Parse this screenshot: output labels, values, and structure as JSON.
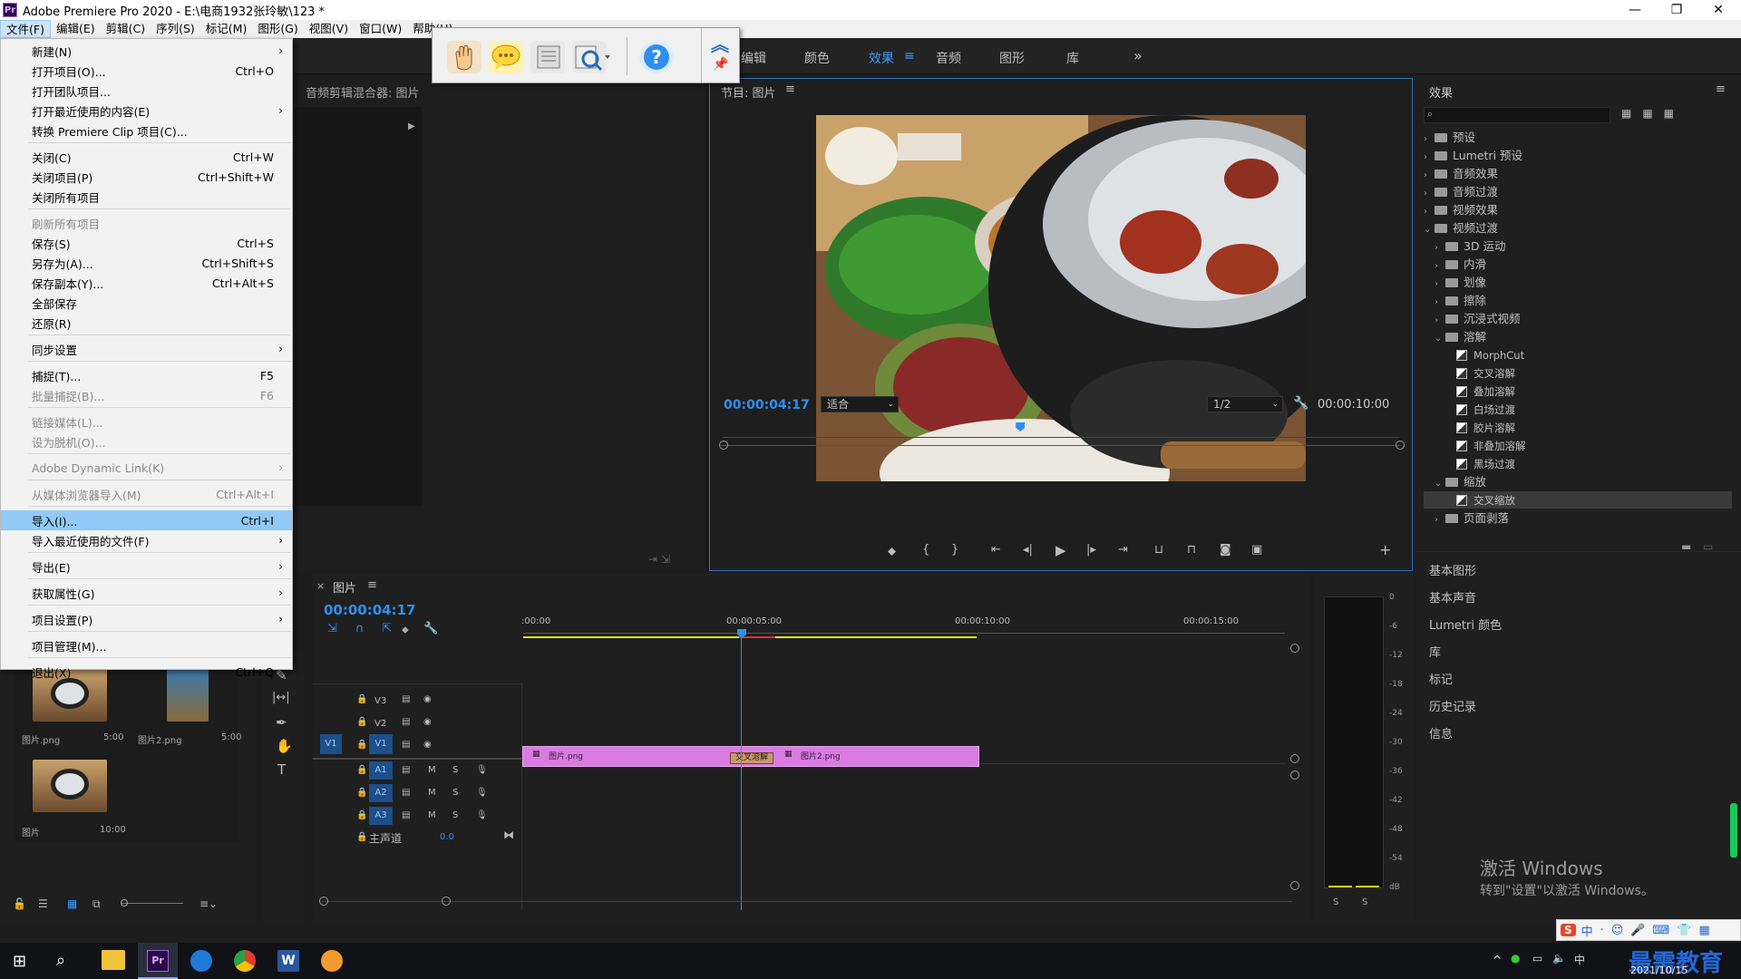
{
  "app": {
    "title": "Adobe Premiere Pro 2020 - E:\\电商1932张玲敏\\123 *",
    "logo": "Pr"
  },
  "window_controls": {
    "minimize": "—",
    "maximize": "❐",
    "close": "✕"
  },
  "menubar": [
    "文件(F)",
    "编辑(E)",
    "剪辑(C)",
    "序列(S)",
    "标记(M)",
    "图形(G)",
    "视图(V)",
    "窗口(W)",
    "帮助(H)"
  ],
  "workspace_tabs": [
    "编辑",
    "颜色",
    "效果",
    "音频",
    "图形",
    "库"
  ],
  "workspace_active": "效果",
  "workspace_more": "»",
  "file_menu": [
    {
      "label": "新建(N)",
      "shortcut": "",
      "arrow": true,
      "disabled": false
    },
    {
      "label": "打开项目(O)...",
      "shortcut": "Ctrl+O",
      "arrow": false,
      "disabled": false
    },
    {
      "label": "打开团队项目...",
      "shortcut": "",
      "arrow": false,
      "disabled": false
    },
    {
      "label": "打开最近使用的内容(E)",
      "shortcut": "",
      "arrow": true,
      "disabled": false
    },
    {
      "label": "转换 Premiere Clip 项目(C)...",
      "shortcut": "",
      "arrow": false,
      "disabled": false
    },
    {
      "label": "关闭(C)",
      "shortcut": "Ctrl+W",
      "arrow": false,
      "disabled": false
    },
    {
      "label": "关闭项目(P)",
      "shortcut": "Ctrl+Shift+W",
      "arrow": false,
      "disabled": false
    },
    {
      "label": "关闭所有项目",
      "shortcut": "",
      "arrow": false,
      "disabled": false
    },
    {
      "label": "刷新所有项目",
      "shortcut": "",
      "arrow": false,
      "disabled": true
    },
    {
      "label": "保存(S)",
      "shortcut": "Ctrl+S",
      "arrow": false,
      "disabled": false
    },
    {
      "label": "另存为(A)...",
      "shortcut": "Ctrl+Shift+S",
      "arrow": false,
      "disabled": false
    },
    {
      "label": "保存副本(Y)...",
      "shortcut": "Ctrl+Alt+S",
      "arrow": false,
      "disabled": false
    },
    {
      "label": "全部保存",
      "shortcut": "",
      "arrow": false,
      "disabled": false
    },
    {
      "label": "还原(R)",
      "shortcut": "",
      "arrow": false,
      "disabled": false
    },
    {
      "label": "同步设置",
      "shortcut": "",
      "arrow": true,
      "disabled": false
    },
    {
      "label": "捕捉(T)...",
      "shortcut": "F5",
      "arrow": false,
      "disabled": false
    },
    {
      "label": "批量捕捉(B)...",
      "shortcut": "F6",
      "arrow": false,
      "disabled": true
    },
    {
      "label": "链接媒体(L)...",
      "shortcut": "",
      "arrow": false,
      "disabled": true
    },
    {
      "label": "设为脱机(O)...",
      "shortcut": "",
      "arrow": false,
      "disabled": true
    },
    {
      "label": "Adobe Dynamic Link(K)",
      "shortcut": "",
      "arrow": true,
      "disabled": true
    },
    {
      "label": "从媒体浏览器导入(M)",
      "shortcut": "Ctrl+Alt+I",
      "arrow": false,
      "disabled": true
    },
    {
      "label": "导入(I)...",
      "shortcut": "Ctrl+I",
      "arrow": false,
      "disabled": false,
      "highlight": true
    },
    {
      "label": "导入最近使用的文件(F)",
      "shortcut": "",
      "arrow": true,
      "disabled": false
    },
    {
      "label": "导出(E)",
      "shortcut": "",
      "arrow": true,
      "disabled": false
    },
    {
      "label": "获取属性(G)",
      "shortcut": "",
      "arrow": true,
      "disabled": false
    },
    {
      "label": "项目设置(P)",
      "shortcut": "",
      "arrow": true,
      "disabled": false
    },
    {
      "label": "项目管理(M)...",
      "shortcut": "",
      "arrow": false,
      "disabled": false
    },
    {
      "label": "退出(X)",
      "shortcut": "Ctrl+Q",
      "arrow": false,
      "disabled": false
    }
  ],
  "source_panel": {
    "title": "音频剪辑混合器: 图片"
  },
  "program": {
    "title": "节目: 图片",
    "timecode": "00:00:04:17",
    "fit": "适合",
    "resolution": "1/2",
    "duration": "00:00:10:00",
    "playhead_fraction": 0.44
  },
  "effects": {
    "title": "效果",
    "tree": [
      {
        "label": "预设",
        "level": 0,
        "type": "folder",
        "open": false
      },
      {
        "label": "Lumetri 预设",
        "level": 0,
        "type": "folder",
        "open": false
      },
      {
        "label": "音频效果",
        "level": 0,
        "type": "folder",
        "open": false
      },
      {
        "label": "音频过渡",
        "level": 0,
        "type": "folder",
        "open": false
      },
      {
        "label": "视频效果",
        "level": 0,
        "type": "folder",
        "open": false
      },
      {
        "label": "视频过渡",
        "level": 0,
        "type": "folder",
        "open": true
      },
      {
        "label": "3D 运动",
        "level": 1,
        "type": "folder",
        "open": false
      },
      {
        "label": "内滑",
        "level": 1,
        "type": "folder",
        "open": false
      },
      {
        "label": "划像",
        "level": 1,
        "type": "folder",
        "open": false
      },
      {
        "label": "擦除",
        "level": 1,
        "type": "folder",
        "open": false
      },
      {
        "label": "沉浸式视频",
        "level": 1,
        "type": "folder",
        "open": false
      },
      {
        "label": "溶解",
        "level": 1,
        "type": "folder",
        "open": true
      },
      {
        "label": "MorphCut",
        "level": 2,
        "type": "fx"
      },
      {
        "label": "交叉溶解",
        "level": 2,
        "type": "fx"
      },
      {
        "label": "叠加溶解",
        "level": 2,
        "type": "fx"
      },
      {
        "label": "白场过渡",
        "level": 2,
        "type": "fx"
      },
      {
        "label": "胶片溶解",
        "level": 2,
        "type": "fx"
      },
      {
        "label": "非叠加溶解",
        "level": 2,
        "type": "fx"
      },
      {
        "label": "黑场过渡",
        "level": 2,
        "type": "fx"
      },
      {
        "label": "缩放",
        "level": 1,
        "type": "folder",
        "open": true
      },
      {
        "label": "交叉缩放",
        "level": 2,
        "type": "fx",
        "selected": true
      },
      {
        "label": "页面剥落",
        "level": 1,
        "type": "folder",
        "open": false
      }
    ],
    "sections": [
      "基本图形",
      "基本声音",
      "Lumetri 颜色",
      "库",
      "标记",
      "历史记录",
      "信息"
    ]
  },
  "timeline": {
    "tab": "图片",
    "timecode": "00:00:04:17",
    "ruler": [
      ":00:00",
      "00:00:05:00",
      "00:00:10:00",
      "00:00:15:00"
    ],
    "video_tracks": [
      "V3",
      "V2",
      "V1"
    ],
    "audio_tracks": [
      "A1",
      "A2",
      "A3"
    ],
    "master": {
      "label": "主声道",
      "value": "0.0"
    },
    "source_patch": "V1",
    "clips": [
      {
        "name": "图片.png"
      },
      {
        "name": "图片2.png"
      }
    ],
    "transition": "交叉溶解",
    "track_buttons": {
      "mute": "M",
      "solo": "S"
    }
  },
  "project_bin": [
    {
      "name": "图片.png",
      "duration": "5:00"
    },
    {
      "name": "图片2.png",
      "duration": "5:00"
    },
    {
      "name": "图片",
      "duration": "10:00"
    }
  ],
  "meter": {
    "scale": [
      "0",
      "-6",
      "-12",
      "-18",
      "-24",
      "-30",
      "-36",
      "-42",
      "-48",
      "-54",
      "dB"
    ],
    "solo": [
      "S",
      "S"
    ]
  },
  "watermark": {
    "line1": "激活 Windows",
    "line2": "转到\"设置\"以激活 Windows。"
  },
  "brand": "最需教育",
  "tray": {
    "date": "2021/10/15",
    "ime": "中"
  }
}
